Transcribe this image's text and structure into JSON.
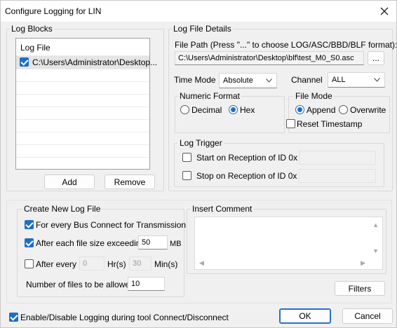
{
  "window": {
    "title": "Configure Logging for LIN"
  },
  "log_blocks": {
    "group_label": "Log Blocks",
    "column_header": "Log File",
    "rows": [
      {
        "checked": true,
        "path": "C:\\Users\\Administrator\\Desktop..."
      }
    ],
    "add_label": "Add",
    "remove_label": "Remove"
  },
  "log_file_details": {
    "group_label": "Log File Details",
    "file_path_label": "File Path (Press \"...\" to choose LOG/ASC/BBD/BLF format):",
    "file_path_value": "C:\\Users\\Administrator\\Desktop\\blf\\test_M0_S0.asc",
    "browse_label": "...",
    "time_mode_label": "Time Mode",
    "time_mode_value": "Absolute",
    "channel_label": "Channel",
    "channel_value": "ALL",
    "numeric_format": {
      "label": "Numeric Format",
      "decimal_label": "Decimal",
      "hex_label": "Hex",
      "selected": "Hex"
    },
    "file_mode": {
      "label": "File Mode",
      "append_label": "Append",
      "overwrite_label": "Overwrite",
      "selected": "Append",
      "reset_timestamp_label": "Reset Timestamp",
      "reset_timestamp_checked": false
    },
    "log_trigger": {
      "label": "Log Trigger",
      "start_label": "Start on Reception of ID 0x",
      "start_checked": false,
      "start_value": "",
      "stop_label": "Stop on Reception of ID 0x",
      "stop_checked": false,
      "stop_value": ""
    }
  },
  "create_new_log_file": {
    "group_label": "Create New Log File",
    "bus_connect_label": "For every Bus Connect for Transmission",
    "bus_connect_checked": true,
    "file_size_label": "After each file size exceeding",
    "file_size_checked": true,
    "file_size_value": "50",
    "file_size_unit": "MB",
    "after_every_label": "After every",
    "after_every_checked": false,
    "hours_value": "0",
    "hours_unit": "Hr(s)",
    "minutes_value": "30",
    "minutes_unit": "Min(s)",
    "num_files_label": "Number of files to be allowed",
    "num_files_value": "10"
  },
  "insert_comment": {
    "group_label": "Insert Comment",
    "value": ""
  },
  "footer": {
    "filters_label": "Filters",
    "enable_logging_label": "Enable/Disable Logging during tool Connect/Disconnect",
    "enable_logging_checked": true,
    "ok_label": "OK",
    "cancel_label": "Cancel"
  },
  "icons": {
    "close": "close-icon",
    "chevron": "chevron-down-icon",
    "scroll_up": "scroll-up-icon",
    "scroll_down": "scroll-down-icon",
    "scroll_left": "scroll-left-icon",
    "scroll_right": "scroll-right-icon"
  },
  "colors": {
    "accent": "#1e6fc2",
    "background": "#f0f0f0"
  }
}
